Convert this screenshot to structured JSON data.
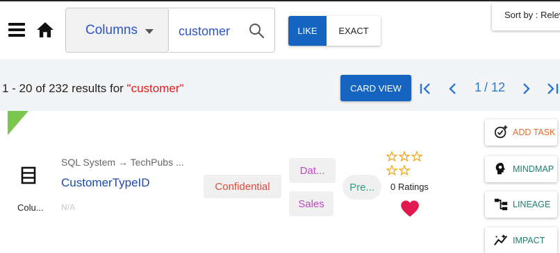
{
  "header": {
    "search_column": "Columns",
    "search_value": "customer",
    "match_like": "LIKE",
    "match_exact": "EXACT",
    "sort_label": "Sort by : Relev"
  },
  "results": {
    "summary_prefix": "1 - 20 of 232 results for ",
    "query": "\"customer\"",
    "card_view_label": "CARD VIEW",
    "pager": {
      "current": "1",
      "separator": "/",
      "total": "12"
    }
  },
  "card": {
    "type_label": "Colu...",
    "source_path": "SQL System → TechPubs ...",
    "asset_name": "CustomerTypeID",
    "description": "N/A",
    "tags": {
      "confidential": "Confidential",
      "dat": "Dat...",
      "sales": "Sales",
      "pre": "Pre..."
    },
    "rating_text": "0 Ratings",
    "actions": {
      "add_task": "ADD TASK",
      "mindmap": "MINDMAP",
      "lineage": "LINEAGE",
      "impact": "IMPACT"
    }
  },
  "colors": {
    "primary": "#1565c0",
    "link": "#1d4aa8",
    "query_highlight": "#e21b1b",
    "star": "#f2a30f",
    "heart": "#e0194e",
    "corner_tag": "#7bc74d"
  },
  "icons": [
    "menu-icon",
    "home-icon",
    "chevron-down-icon",
    "search-icon",
    "first-page-icon",
    "chevron-left-icon",
    "chevron-right-icon",
    "last-page-icon",
    "column-type-icon",
    "star-icon",
    "heart-icon",
    "add-task-icon",
    "mindmap-icon",
    "lineage-icon",
    "impact-icon"
  ]
}
